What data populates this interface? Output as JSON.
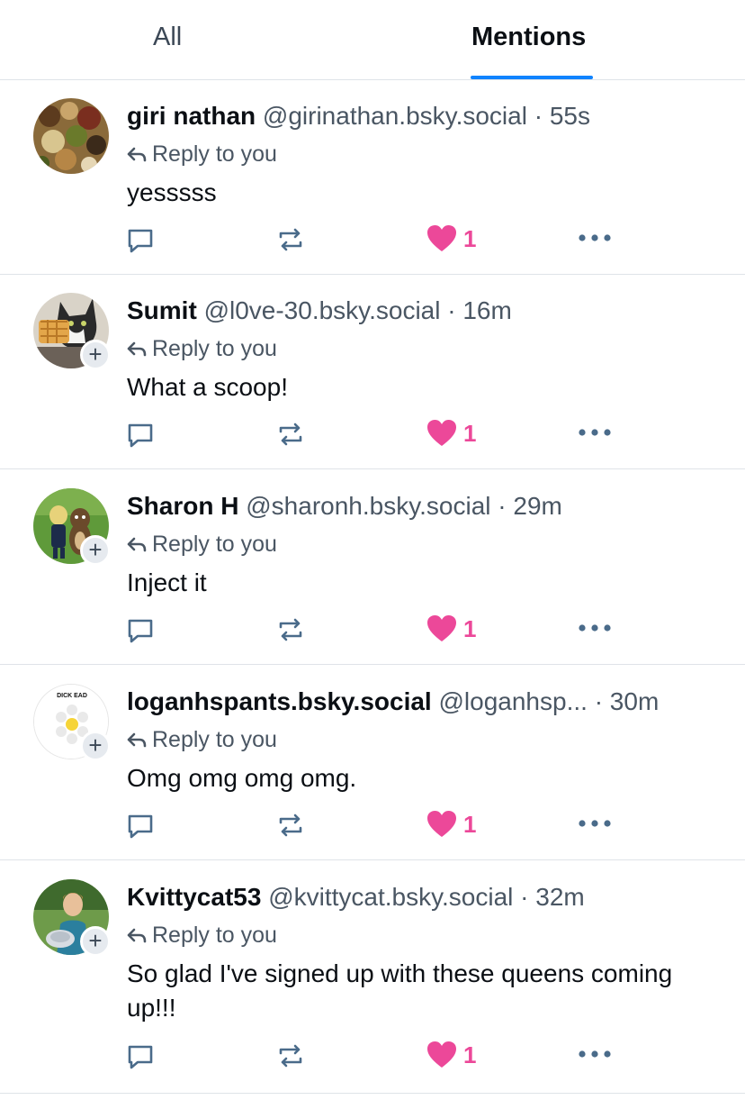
{
  "tabs": {
    "all": "All",
    "mentions": "Mentions",
    "active": "Mentions"
  },
  "colors": {
    "accent": "#1083fe",
    "like": "#ec4899",
    "muted": "#4a5663",
    "divider": "#dfe3e8"
  },
  "posts": [
    {
      "display_name": "giri nathan",
      "handle": "@girinathan.bsky.social",
      "separator": "·",
      "time": "55s",
      "reply_label": "Reply to you",
      "text": "yesssss",
      "like_count": "1",
      "avatar_icon": "food-photo-avatar",
      "has_follow_badge": false
    },
    {
      "display_name": "Sumit",
      "handle": "@l0ve-30.bsky.social",
      "separator": "·",
      "time": "16m",
      "reply_label": "Reply to you",
      "text": "What a scoop!",
      "like_count": "1",
      "avatar_icon": "cat-avatar",
      "has_follow_badge": true
    },
    {
      "display_name": "Sharon H",
      "handle": "@sharonh.bsky.social",
      "separator": "·",
      "time": "29m",
      "reply_label": "Reply to you",
      "text": "Inject it",
      "like_count": "1",
      "avatar_icon": "mascots-avatar",
      "has_follow_badge": true
    },
    {
      "display_name": "loganhspants.bsky.social",
      "handle": "@loganhsp...",
      "separator": "·",
      "time": "30m",
      "reply_label": "Reply to you",
      "text": "Omg omg omg omg.",
      "like_count": "1",
      "avatar_icon": "word-game-avatar",
      "avatar_text": "DICK EAD",
      "has_follow_badge": true
    },
    {
      "display_name": "Kvittycat53",
      "handle": "@kvittycat.bsky.social",
      "separator": "·",
      "time": "32m",
      "reply_label": "Reply to you",
      "text": "So glad I've signed up with these queens coming up!!!",
      "like_count": "1",
      "avatar_icon": "tennis-player-avatar",
      "has_follow_badge": true
    }
  ]
}
